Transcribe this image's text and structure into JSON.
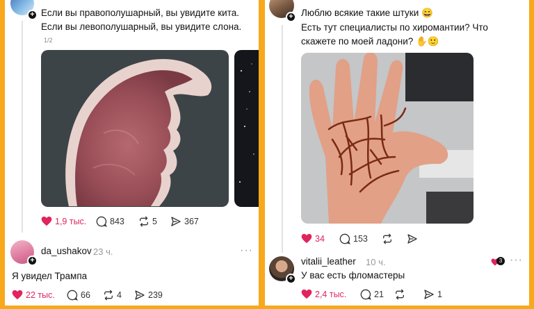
{
  "left_post": {
    "text_line1": "Если вы правополушарный, вы увидите кита.",
    "text_line2": "Если вы левополушарный, вы увидите слона.",
    "pager": "1/2",
    "actions": {
      "likes": "1,9 тыс.",
      "comments": "843",
      "reposts": "5",
      "shares": "367"
    }
  },
  "left_reply": {
    "username": "da_ushakov",
    "time": "23 ч.",
    "text": "Я увидел Трампа",
    "actions": {
      "likes": "22 тыс.",
      "comments": "66",
      "reposts": "4",
      "shares": "239"
    }
  },
  "right_post": {
    "text_line1": "Люблю всякие такие штуки 😄",
    "text_line2": "Есть тут специалисты по хиромантии? Что",
    "text_line3": "скажете по моей ладони? ✋🙂",
    "actions": {
      "likes": "34",
      "comments": "153"
    }
  },
  "right_reply": {
    "username": "vitalii_leather",
    "time": "10 ч.",
    "text": "У вас есть фломастеры",
    "mini_like_count": "3",
    "actions": {
      "likes": "2,4 тыс.",
      "comments": "21",
      "shares": "1"
    }
  },
  "colors": {
    "frame": "#f7a81b",
    "like": "#e0245e",
    "muted": "#999999"
  }
}
